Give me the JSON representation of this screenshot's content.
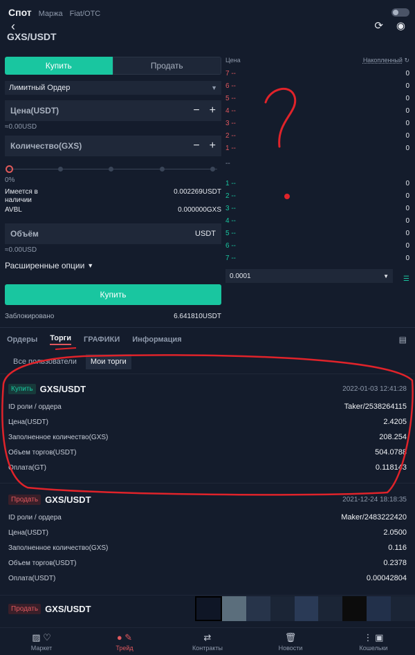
{
  "topbar": {
    "tab_spot": "Спот",
    "tab_margin": "Маржа",
    "tab_fiat": "Fiat/OTC",
    "pair": "GXS/USDT"
  },
  "form": {
    "buy_tab": "Купить",
    "sell_tab": "Продать",
    "order_type": "Лимитный Ордер",
    "price_label": "Цена(USDT)",
    "price_usd": "≈0.00USD",
    "qty_label": "Количество(GXS)",
    "slider_pct": "0%",
    "available_label": "Имеется в наличии",
    "available_value": "0.002269USDT",
    "avbl_label": "AVBL",
    "avbl_value": "0.000000GXS",
    "volume_label": "Объём",
    "volume_unit": "USDT",
    "volume_usd": "≈0.00USD",
    "advanced": "Расширенные опции",
    "buy_button": "Купить",
    "locked_label": "Заблокировано",
    "locked_value": "6.641810USDT"
  },
  "book": {
    "price_header": "Цена",
    "cumulative_header": "Накопленный",
    "asks": [
      {
        "idx": "7",
        "price": "--",
        "qty": "0"
      },
      {
        "idx": "6",
        "price": "--",
        "qty": "0"
      },
      {
        "idx": "5",
        "price": "--",
        "qty": "0"
      },
      {
        "idx": "4",
        "price": "--",
        "qty": "0"
      },
      {
        "idx": "3",
        "price": "--",
        "qty": "0"
      },
      {
        "idx": "2",
        "price": "--",
        "qty": "0"
      },
      {
        "idx": "1",
        "price": "--",
        "qty": "0"
      }
    ],
    "mid": "--",
    "bids": [
      {
        "idx": "1",
        "price": "--",
        "qty": "0"
      },
      {
        "idx": "2",
        "price": "--",
        "qty": "0"
      },
      {
        "idx": "3",
        "price": "--",
        "qty": "0"
      },
      {
        "idx": "4",
        "price": "--",
        "qty": "0"
      },
      {
        "idx": "5",
        "price": "--",
        "qty": "0"
      },
      {
        "idx": "6",
        "price": "--",
        "qty": "0"
      },
      {
        "idx": "7",
        "price": "--",
        "qty": "0"
      }
    ],
    "precision": "0.0001"
  },
  "sections": {
    "orders": "Ордеры",
    "trades": "Торги",
    "charts": "ГРАФИКИ",
    "info": "Информация",
    "all_users": "Все пользователи",
    "my_trades": "Мои торги"
  },
  "trades": [
    {
      "side": "Купить",
      "pair": "GXS/USDT",
      "date": "2022-01-03 12:41:28",
      "role_label": "ID роли / ордера",
      "role_value": "Taker/2538264115",
      "price_label": "Цена(USDT)",
      "price_value": "2.4205",
      "filled_label": "Заполненное количество(GXS)",
      "filled_value": "208.254",
      "volume_label": "Объем торгов(USDT)",
      "volume_value": "504.0788",
      "fee_label": "Оплата(GT)",
      "fee_value": "0.118143"
    },
    {
      "side": "Продать",
      "pair": "GXS/USDT",
      "date": "2021-12-24 18:18:35",
      "role_label": "ID роли / ордера",
      "role_value": "Maker/2483222420",
      "price_label": "Цена(USDT)",
      "price_value": "2.0500",
      "filled_label": "Заполненное количество(GXS)",
      "filled_value": "0.116",
      "volume_label": "Объем торгов(USDT)",
      "volume_value": "0.2378",
      "fee_label": "Оплата(USDT)",
      "fee_value": "0.00042804"
    },
    {
      "side": "Продать",
      "pair": "GXS/USDT"
    }
  ],
  "nav": {
    "market": "Маркет",
    "trade": "Трейд",
    "contracts": "Контракты",
    "news": "Новости",
    "wallets": "Кошельки"
  },
  "colors": {
    "accent_green": "#19c6a0",
    "accent_red": "#e0585e",
    "background": "#141c2c",
    "annotation_red": "#e0232a"
  }
}
